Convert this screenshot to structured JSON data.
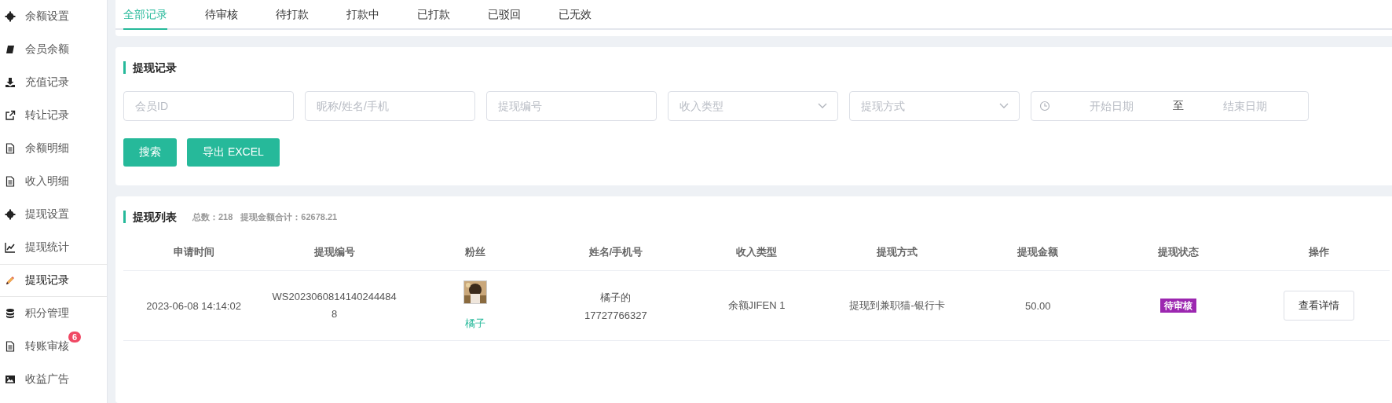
{
  "sidebar": {
    "items": [
      {
        "label": "余额设置",
        "selected": false
      },
      {
        "label": "会员余额",
        "selected": false
      },
      {
        "label": "充值记录",
        "selected": false
      },
      {
        "label": "转让记录",
        "selected": false
      },
      {
        "label": "余额明细",
        "selected": false
      },
      {
        "label": "收入明细",
        "selected": false
      },
      {
        "label": "提现设置",
        "selected": false
      },
      {
        "label": "提现统计",
        "selected": false
      },
      {
        "label": "提现记录",
        "selected": true
      },
      {
        "label": "积分管理",
        "selected": false
      },
      {
        "label": "转账审核",
        "selected": false,
        "badge": "6"
      },
      {
        "label": "收益广告",
        "selected": false
      }
    ]
  },
  "tabs": [
    {
      "label": "全部记录",
      "selected": true
    },
    {
      "label": "待审核",
      "selected": false
    },
    {
      "label": "待打款",
      "selected": false
    },
    {
      "label": "打款中",
      "selected": false
    },
    {
      "label": "已打款",
      "selected": false
    },
    {
      "label": "已驳回",
      "selected": false
    },
    {
      "label": "已无效",
      "selected": false
    }
  ],
  "filter": {
    "title": "提现记录",
    "fields": [
      {
        "kind": "input",
        "placeholder": "会员ID"
      },
      {
        "kind": "input",
        "placeholder": "昵称/姓名/手机"
      },
      {
        "kind": "input",
        "placeholder": "提现编号"
      },
      {
        "kind": "select",
        "placeholder": "收入类型"
      },
      {
        "kind": "select",
        "placeholder": "提现方式"
      }
    ],
    "date_range": {
      "start_placeholder": "开始日期",
      "separator": "至",
      "end_placeholder": "结束日期"
    },
    "buttons": [
      "搜索",
      "导出 EXCEL"
    ]
  },
  "list": {
    "title": "提现列表",
    "total": "总数：218",
    "sum": "提现金额合计：62678.21",
    "columns": [
      "申请时间",
      "提现编号",
      "粉丝",
      "姓名/手机号",
      "收入类型",
      "提现方式",
      "提现金额",
      "提现状态",
      "操作"
    ],
    "rows": [
      {
        "time": "2023-06-08 14:14:02",
        "number": "WS20230608141402444848",
        "fan": {
          "kind": "picture",
          "name": "橘子"
        },
        "name": "橘子的",
        "phone": "17727766327",
        "income_type": "余额JIFEN 1",
        "method": "提现到兼职猫-银行卡",
        "amount": "50.00",
        "status": "待审核",
        "color": "#9c27b0",
        "action": "查看详情"
      }
    ]
  }
}
